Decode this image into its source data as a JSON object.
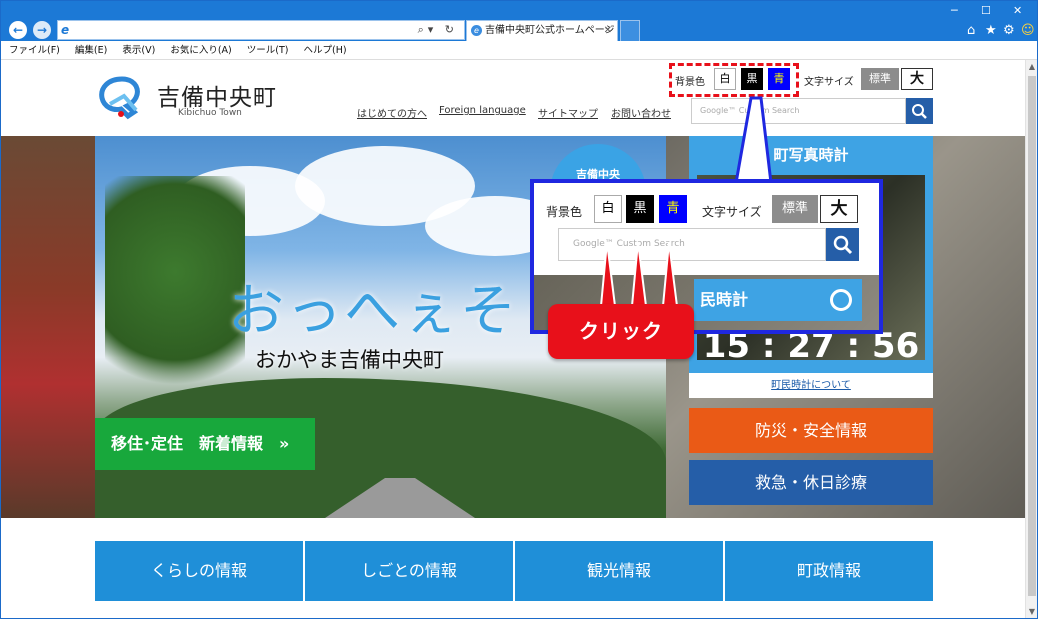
{
  "browser": {
    "tab_title": "吉備中央町公式ホームページ",
    "menu": [
      "ファイル(F)",
      "編集(E)",
      "表示(V)",
      "お気に入り(A)",
      "ツール(T)",
      "ヘルプ(H)"
    ]
  },
  "header": {
    "site_name": "吉備中央町",
    "site_name_romaji": "Kibichuo Town",
    "links": [
      "はじめての方へ",
      "Foreign language",
      "サイトマップ",
      "お問い合わせ"
    ],
    "search_placeholder": "Google™ Custom Search",
    "bg_color_label": "背景色",
    "bg_colors": [
      "白",
      "黒",
      "青"
    ],
    "text_size_label": "文字サイズ",
    "text_size_standard": "標準",
    "text_size_large": "大"
  },
  "hero": {
    "slogan": "おっへぇそぅ",
    "slogan_sub": "おかやま吉備中央町",
    "badge": "吉備中央",
    "move_button": "移住･定住　新着情報　»"
  },
  "side": {
    "photo_clock_title": "町写真時計",
    "clock_time": "15 : 27 : 56",
    "clock_link": "町民時計について",
    "bosai": "防災・安全情報",
    "kyukyu": "救急・休日診療"
  },
  "infonav": [
    "くらしの情報",
    "しごとの情報",
    "観光情報",
    "町政情報"
  ],
  "zoom": {
    "bg_color_label": "背景色",
    "bg_colors": [
      "白",
      "黒",
      "青"
    ],
    "text_size_label": "文字サイズ",
    "text_size_standard": "標準",
    "text_size_large": "大",
    "search_placeholder": "Google™ Custom Search",
    "clock_title": "民時計",
    "click_label": "クリック"
  },
  "colors": {
    "ie_blue": "#1c79d6",
    "highlight_red": "#e8101a",
    "callout_blue": "#1f28e0",
    "bosai_orange": "#ea5a16",
    "nav_blue": "#1f8fd8",
    "green": "#18a83c"
  }
}
